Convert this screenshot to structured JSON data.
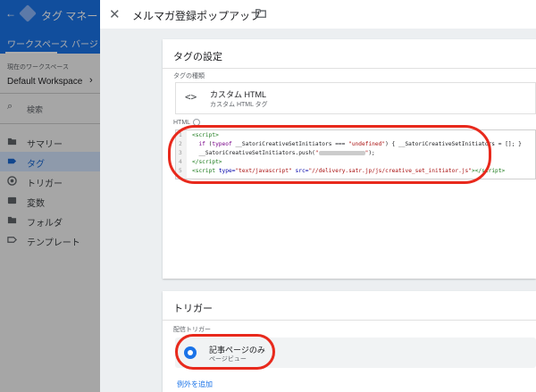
{
  "background_app": {
    "title": "タグ マネー",
    "tabs": [
      "ワークスペース",
      "バージョ"
    ],
    "workspace_label": "現在のワークスペース",
    "workspace_name": "Default Workspace",
    "search_label": "検索",
    "nav": [
      {
        "label": "サマリー",
        "icon": "folder-icon"
      },
      {
        "label": "タグ",
        "icon": "tag-icon"
      },
      {
        "label": "トリガー",
        "icon": "trigger-icon"
      },
      {
        "label": "変数",
        "icon": "variable-icon"
      },
      {
        "label": "フォルダ",
        "icon": "folder-icon"
      },
      {
        "label": "テンプレート",
        "icon": "template-icon"
      }
    ]
  },
  "panel": {
    "close_symbol": "✕",
    "title": "メルマガ登録ポップアップ"
  },
  "tag_config": {
    "title": "タグの設定",
    "type_label": "タグの種類",
    "type_icon": "<>",
    "type_name": "カスタム HTML",
    "type_desc": "カスタム HTML タグ",
    "html_label": "HTML",
    "line_numbers": [
      "1",
      "2",
      "3",
      "4",
      "5"
    ]
  },
  "trigger": {
    "title": "トリガー",
    "firing_label": "配信トリガー",
    "item_name": "記事ページのみ",
    "item_type": "ページビュー",
    "add_exception": "例外を追加"
  },
  "colors": {
    "accent": "#1a73e8",
    "highlight": "#e8291c",
    "code_tag": "#1b7a1b",
    "code_string": "#aa1111"
  }
}
